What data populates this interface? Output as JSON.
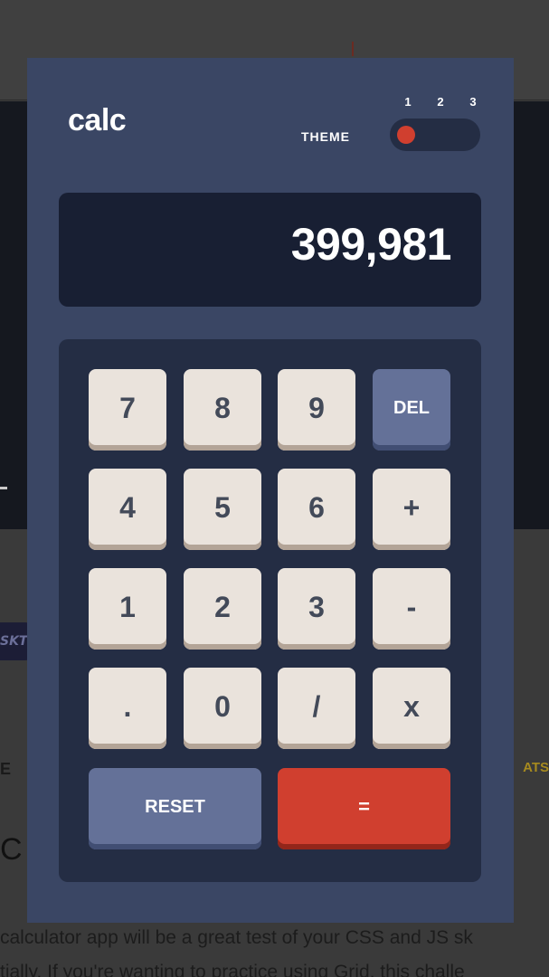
{
  "background_page": {
    "tag_text": "SKT",
    "left_heading_fragment": "E",
    "right_fragment": "ATS",
    "left_letter": "C",
    "paragraph_lines": [
      "calculator app will be a great test of your CSS and JS sk",
      "tially. If you're wanting to practice using Grid, this challe"
    ]
  },
  "calculator": {
    "brand": "calc",
    "theme": {
      "label": "THEME",
      "options": [
        "1",
        "2",
        "3"
      ],
      "selected": "1"
    },
    "display": "399,981",
    "keys": {
      "k7": "7",
      "k8": "8",
      "k9": "9",
      "del": "DEL",
      "k4": "4",
      "k5": "5",
      "k6": "6",
      "plus": "+",
      "k1": "1",
      "k2": "2",
      "k3": "3",
      "minus": "-",
      "dot": ".",
      "k0": "0",
      "divide": "/",
      "multiply": "x",
      "reset": "RESET",
      "equals": "="
    }
  },
  "colors": {
    "card_bg": "#3a4664",
    "display_bg": "#181f33",
    "keypad_bg": "#242d44",
    "key_bg": "#eae3dc",
    "key_shadow": "#b3a497",
    "key_text": "#434a59",
    "blue_key": "#647198",
    "red_key": "#d03f2f"
  }
}
